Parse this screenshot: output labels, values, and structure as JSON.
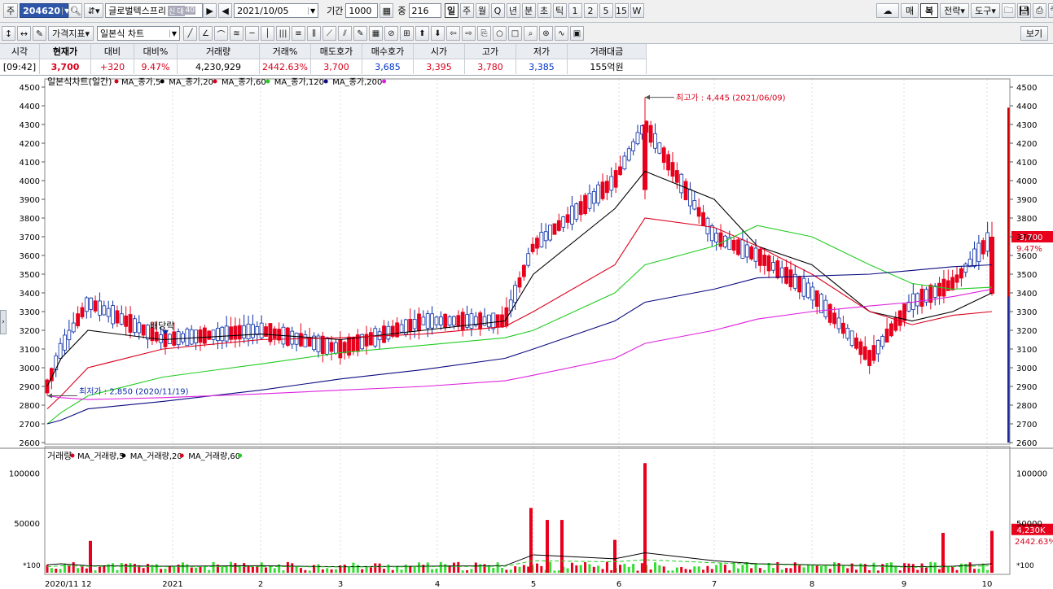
{
  "toolbar1": {
    "market_label": "주",
    "stock_code": "204620",
    "stock_name": "글로벌텍스프리",
    "tags": [
      "신",
      "대",
      "40"
    ],
    "date": "2021/10/05",
    "period_label": "기간",
    "period_value": "1000",
    "count_label": "중",
    "count_value": "216",
    "timeframes": [
      "일",
      "주",
      "월",
      "Q",
      "년",
      "분",
      "초",
      "틱",
      "1",
      "2",
      "5",
      "15",
      "W"
    ],
    "active_timeframe": "일",
    "right_buttons": [
      "매",
      "복",
      "전략",
      "도구"
    ]
  },
  "toolbar2": {
    "price_index_label": "가격지표",
    "chart_type": "일본식 차트",
    "right_button": "보기"
  },
  "quote": {
    "headers": [
      "시각",
      "현재가",
      "대비",
      "대비%",
      "거래량",
      "거래%",
      "매도호가",
      "매수호가",
      "시가",
      "고가",
      "저가",
      "거래대금"
    ],
    "values": [
      "[09:42]",
      "3,700",
      "+320",
      "9.47%",
      "4,230,929",
      "2442.63%",
      "3,700",
      "3,685",
      "3,395",
      "3,780",
      "3,385",
      "155억원"
    ]
  },
  "chart_data": [
    {
      "type": "candlestick",
      "title": "일본식차트(일간)",
      "legend": [
        "MA_종가,5",
        "MA_종가,20",
        "MA_종가,60",
        "MA_종가,120",
        "MA_종가,200"
      ],
      "legend_colors": [
        "#d9001b",
        "#000000",
        "#d9001b",
        "#22cc22",
        "#0a0a80",
        "#dd22dd"
      ],
      "y_ticks": [
        4500,
        4400,
        4300,
        4200,
        4100,
        4000,
        3900,
        3800,
        3700,
        3600,
        3500,
        3400,
        3300,
        3200,
        3100,
        3000,
        2900,
        2800,
        2700,
        2600
      ],
      "ylim": [
        2600,
        4500
      ],
      "x_labels": [
        "2020/11 12",
        "2021",
        "2",
        "3",
        "4",
        "5",
        "6",
        "7",
        "8",
        "9",
        "10"
      ],
      "annotations": {
        "high": "최고가 : 4,445 (2021/06/09)",
        "low": "최저가 : 2,850 (2020/11/19)",
        "dividend": "배당락"
      },
      "current_price": "3,700",
      "current_pct": "9.47%",
      "ohlc_anchors": [
        {
          "x": "2020/11",
          "close": 2900
        },
        {
          "x": "2020/12",
          "close": 3100
        },
        {
          "x": "2020/12 mid",
          "close": 3350
        },
        {
          "x": "2021/01",
          "close": 3150
        },
        {
          "x": "2021/02",
          "close": 3200
        },
        {
          "x": "2021/03",
          "close": 3100
        },
        {
          "x": "2021/04",
          "close": 3250
        },
        {
          "x": "2021/04 end",
          "close": 3250
        },
        {
          "x": "2021/05",
          "close": 3650
        },
        {
          "x": "2021/06",
          "close": 4000
        },
        {
          "x": "2021/06/09",
          "close": 4300
        },
        {
          "x": "2021/07",
          "close": 3700
        },
        {
          "x": "2021/07 mid",
          "close": 3600
        },
        {
          "x": "2021/08",
          "close": 3400
        },
        {
          "x": "2021/08 end",
          "close": 3050
        },
        {
          "x": "2021/09",
          "close": 3350
        },
        {
          "x": "2021/09 end",
          "close": 3450
        },
        {
          "x": "2021/10",
          "close": 3700
        }
      ],
      "ma_series": {
        "ma20": [
          2900,
          3050,
          3200,
          3150,
          3180,
          3150,
          3200,
          3250,
          3500,
          3850,
          4050,
          3900,
          3650,
          3550,
          3300,
          3250,
          3300,
          3400
        ],
        "ma60": [
          2780,
          2850,
          3000,
          3100,
          3150,
          3160,
          3180,
          3220,
          3300,
          3550,
          3800,
          3750,
          3650,
          3500,
          3300,
          3230,
          3280,
          3300
        ],
        "ma120": [
          2700,
          2760,
          2850,
          2950,
          3020,
          3080,
          3120,
          3160,
          3200,
          3400,
          3550,
          3650,
          3760,
          3700,
          3550,
          3450,
          3420,
          3430
        ],
        "ma200": [
          2700,
          2720,
          2780,
          2820,
          2880,
          2940,
          2990,
          3050,
          3100,
          3250,
          3350,
          3420,
          3480,
          3490,
          3500,
          3520,
          3540,
          3550
        ],
        "ma_pink": [
          2850,
          2840,
          2830,
          2840,
          2860,
          2880,
          2900,
          2930,
          2960,
          3050,
          3130,
          3200,
          3260,
          3300,
          3330,
          3350,
          3380,
          3420
        ]
      }
    },
    {
      "type": "bar",
      "title": "거래량",
      "legend": [
        "MA_거래량,5",
        "MA_거래량,20",
        "MA_거래량,60"
      ],
      "legend_colors": [
        "#d9001b",
        "#000000",
        "#d9001b",
        "#22cc22"
      ],
      "y_ticks": [
        100000,
        50000
      ],
      "unit_label": "*100",
      "current_volume": "4,230K",
      "current_pct": "2442.63%",
      "spikes": [
        {
          "x": "2020/12",
          "value": 32000
        },
        {
          "x": "2021/05",
          "value": 65000
        },
        {
          "x": "2021/05 mid",
          "value": 53000
        },
        {
          "x": "2021/05 late",
          "value": 53000
        },
        {
          "x": "2021/06",
          "value": 33000
        },
        {
          "x": "2021/06/09",
          "value": 110000
        },
        {
          "x": "2021/09 end",
          "value": 40000
        },
        {
          "x": "2021/10",
          "value": 42000
        }
      ]
    }
  ]
}
